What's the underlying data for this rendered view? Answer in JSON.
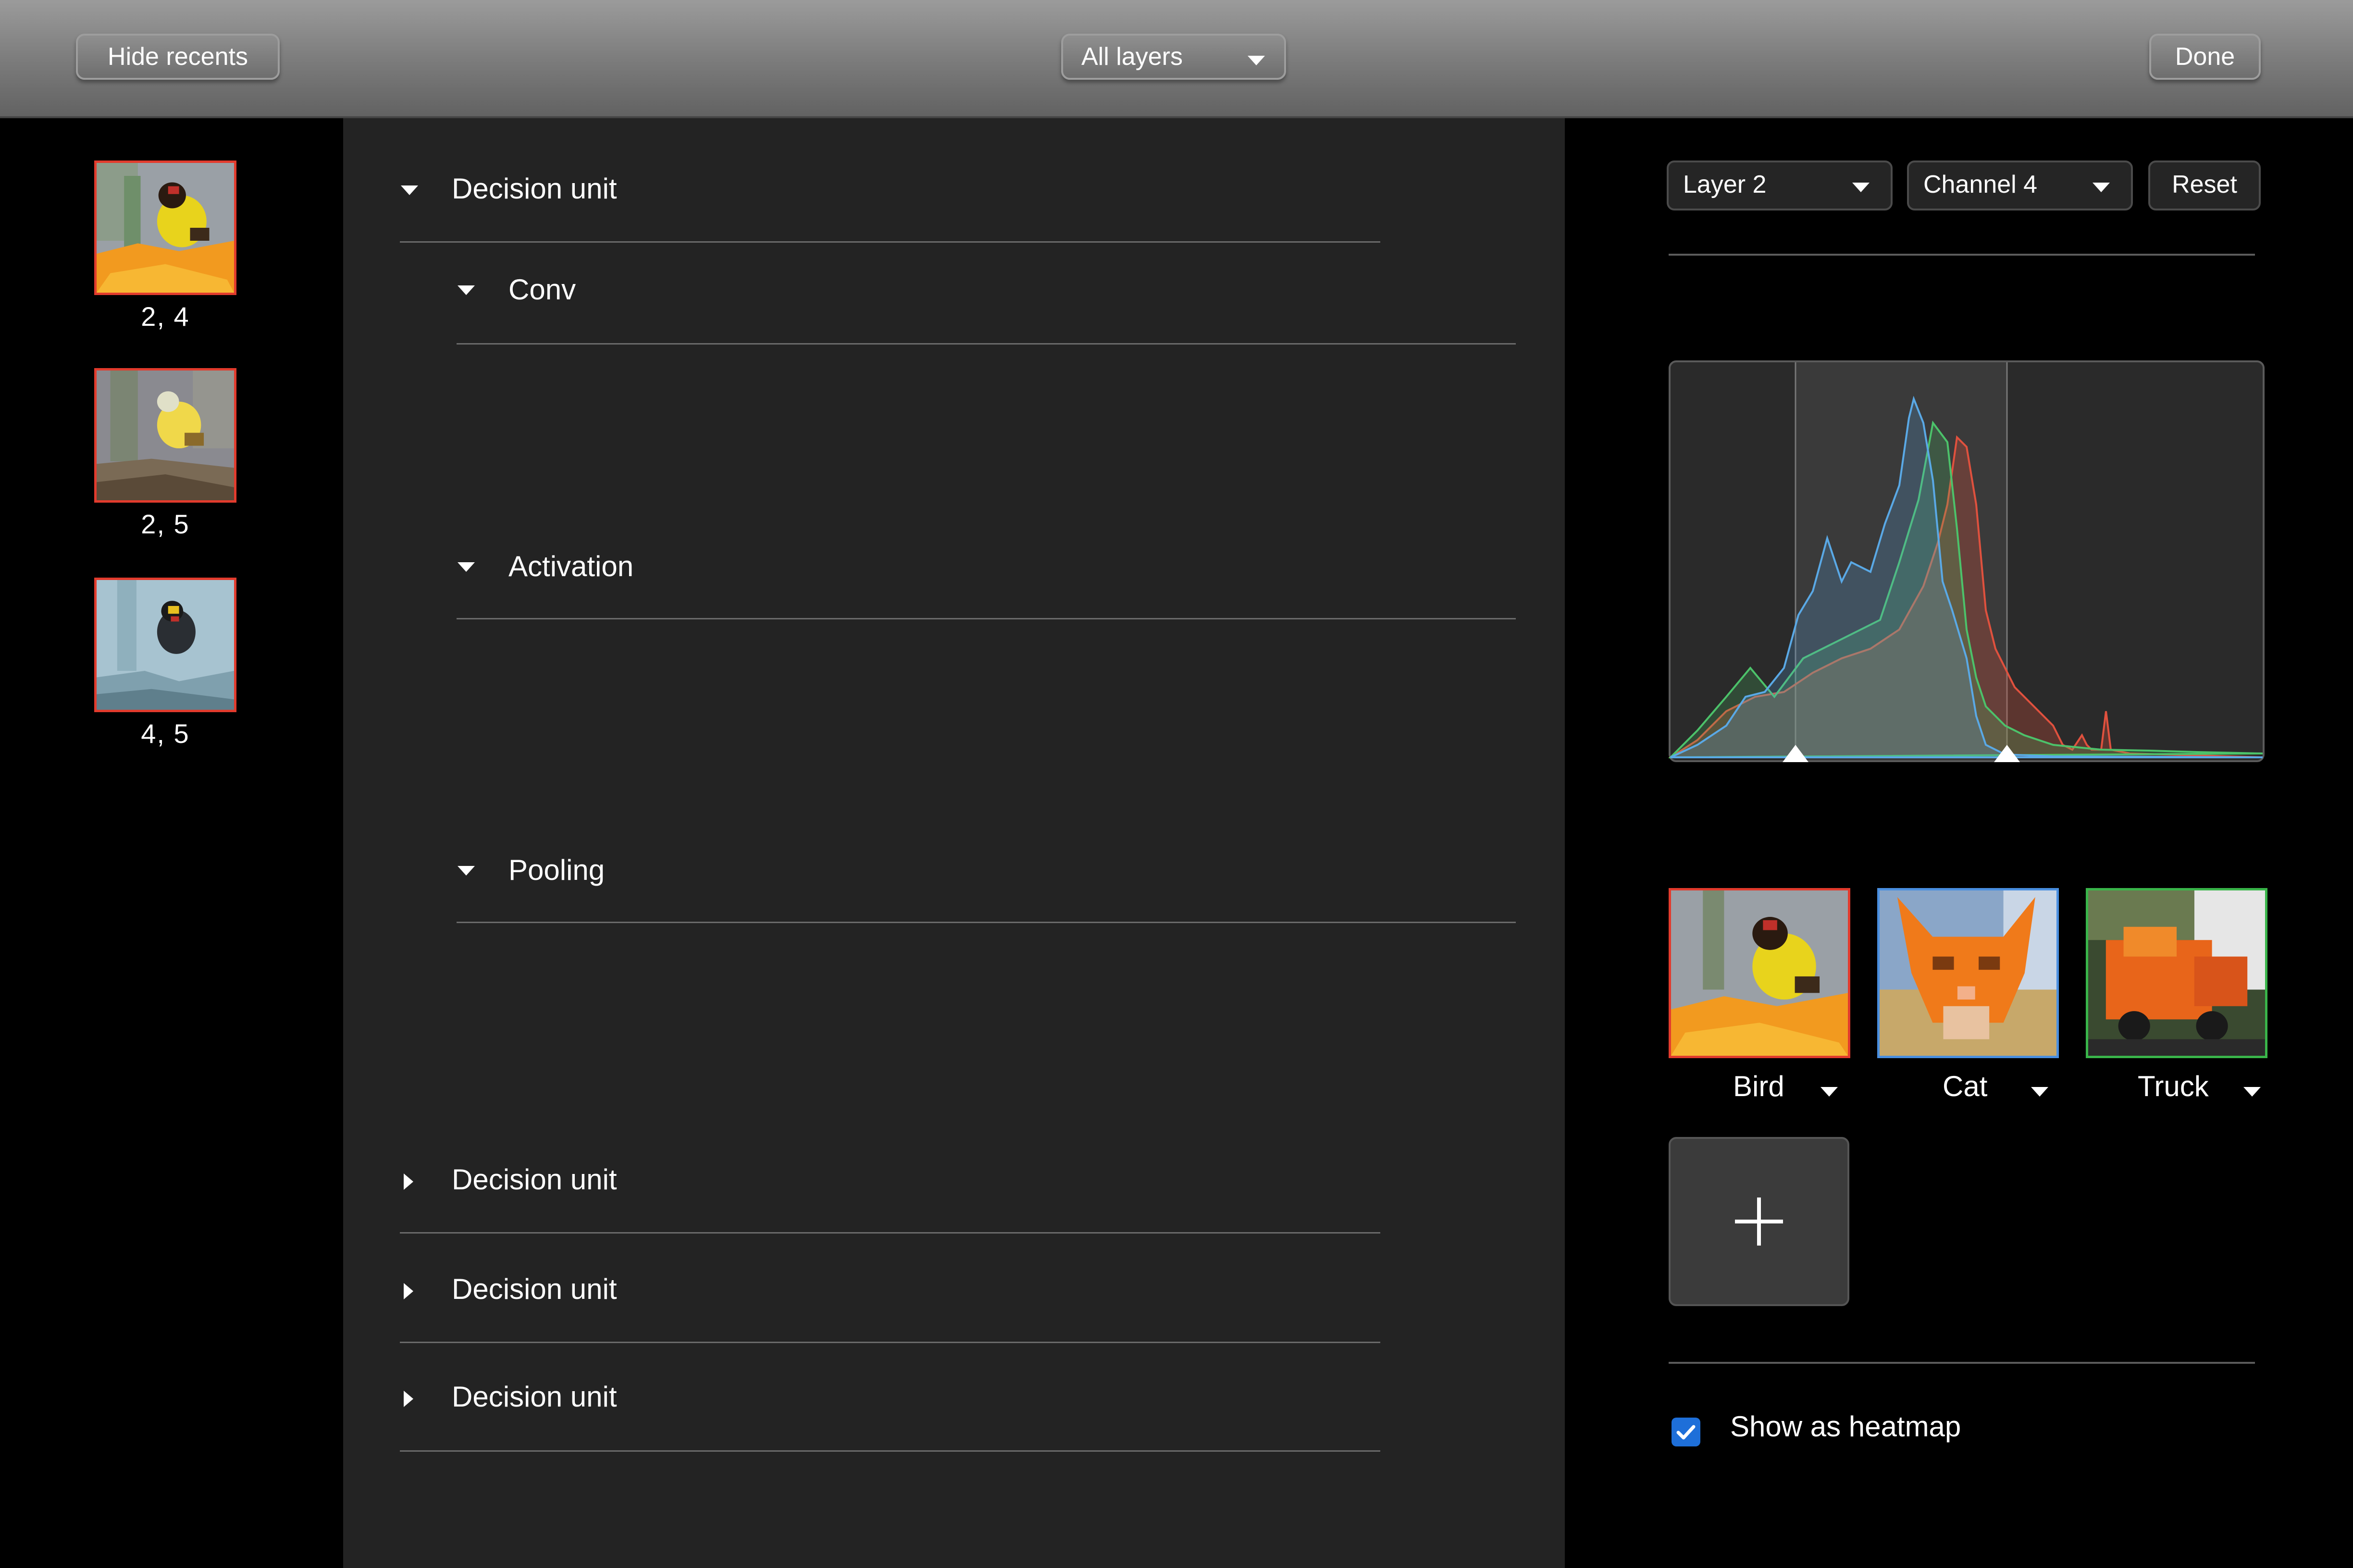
{
  "topbar": {
    "hide_recents_label": "Hide recents",
    "layers_select_value": "All layers",
    "done_label": "Done"
  },
  "recents": [
    {
      "label": "2, 4"
    },
    {
      "label": "2, 5"
    },
    {
      "label": "4, 5"
    }
  ],
  "tree": {
    "unit1": {
      "label": "Decision unit",
      "children": [
        {
          "label": "Conv"
        },
        {
          "label": "Activation"
        },
        {
          "label": "Pooling"
        }
      ]
    },
    "collapsed_units": [
      {
        "label": "Decision unit"
      },
      {
        "label": "Decision unit"
      },
      {
        "label": "Decision unit"
      }
    ]
  },
  "controls": {
    "layer_select_value": "Layer 2",
    "channel_select_value": "Channel 4",
    "reset_label": "Reset"
  },
  "histogram": {
    "series_colors": {
      "red": "#e0513e",
      "green": "#4cc26a",
      "blue": "#5aa9e6"
    }
  },
  "classes": [
    {
      "label": "Bird",
      "border_color": "#e23b2d"
    },
    {
      "label": "Cat",
      "border_color": "#4a8fe0"
    },
    {
      "label": "Truck",
      "border_color": "#39b54a"
    }
  ],
  "heatmap": {
    "label": "Show as heatmap",
    "checked": true
  },
  "icons": {
    "add": "plus-icon",
    "check": "check-icon",
    "expand": "triangle-down-icon",
    "collapse": "triangle-right-icon"
  }
}
